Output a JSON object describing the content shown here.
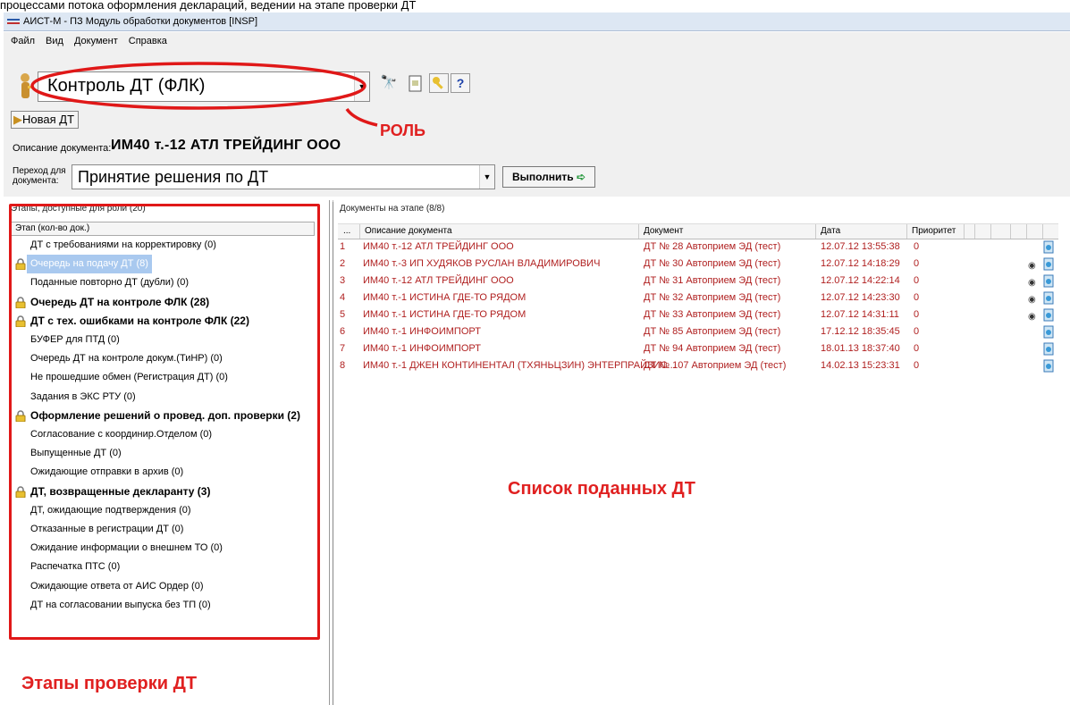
{
  "top_text": "процессами потока оформления деклараций, ведении на этапе проверки ДТ",
  "window": {
    "title": "АИСТ-М - ПЗ Модуль обработки документов [INSP]"
  },
  "menu": [
    "Файл",
    "Вид",
    "Документ",
    "Справка"
  ],
  "role": {
    "value": "Контроль ДТ (ФЛК)"
  },
  "toolbar": {
    "new_dt": "Новая ДТ",
    "exec": "Выполнить"
  },
  "document": {
    "desc_label": "Описание документа:",
    "desc_value": "ИМ40 т.-12 АТЛ ТРЕЙДИНГ ООО",
    "transition_label_1": "Переход для",
    "transition_label_2": "документа:",
    "transition_value": "Принятие решения по ДТ"
  },
  "stages_panel": {
    "caption": "Этапы, доступные для роли (20)",
    "header": "Этап (кол-во док.)",
    "items": [
      {
        "label": "ДТ с требованиями на корректировку (0)",
        "bold": false,
        "lock": false,
        "selected": false
      },
      {
        "label": "Очередь на подачу ДТ (8)",
        "bold": false,
        "lock": true,
        "selected": true
      },
      {
        "label": "Поданные повторно ДТ (дубли) (0)",
        "bold": false,
        "lock": false,
        "selected": false
      },
      {
        "label": "Очередь ДТ на контроле ФЛК (28)",
        "bold": true,
        "lock": true,
        "selected": false
      },
      {
        "label": "ДТ с тех. ошибками на контроле ФЛК (22)",
        "bold": true,
        "lock": true,
        "selected": false
      },
      {
        "label": "БУФЕР для ПТД (0)",
        "bold": false,
        "lock": false,
        "selected": false
      },
      {
        "label": "Очередь ДТ на контроле докум.(ТиНР) (0)",
        "bold": false,
        "lock": false,
        "selected": false
      },
      {
        "label": "Не прошедшие обмен (Регистрация ДТ) (0)",
        "bold": false,
        "lock": false,
        "selected": false
      },
      {
        "label": "Задания в ЭКС РТУ (0)",
        "bold": false,
        "lock": false,
        "selected": false
      },
      {
        "label": "Оформление решений о провед. доп. проверки (2)",
        "bold": true,
        "lock": true,
        "selected": false
      },
      {
        "label": "Согласование с координир.Отделом (0)",
        "bold": false,
        "lock": false,
        "selected": false
      },
      {
        "label": "Выпущенные ДТ (0)",
        "bold": false,
        "lock": false,
        "selected": false
      },
      {
        "label": "Ожидающие отправки в архив (0)",
        "bold": false,
        "lock": false,
        "selected": false
      },
      {
        "label": "ДТ, возвращенные декларанту (3)",
        "bold": true,
        "lock": true,
        "selected": false
      },
      {
        "label": "ДТ, ожидающие подтверждения (0)",
        "bold": false,
        "lock": false,
        "selected": false
      },
      {
        "label": "Отказанные в регистрации ДТ (0)",
        "bold": false,
        "lock": false,
        "selected": false
      },
      {
        "label": "Ожидание информации о внешнем ТО (0)",
        "bold": false,
        "lock": false,
        "selected": false
      },
      {
        "label": "Распечатка ПТС (0)",
        "bold": false,
        "lock": false,
        "selected": false
      },
      {
        "label": "Ожидающие ответа от АИС Ордер (0)",
        "bold": false,
        "lock": false,
        "selected": false
      },
      {
        "label": "ДТ на согласовании выпуска без ТП (0)",
        "bold": false,
        "lock": false,
        "selected": false
      }
    ]
  },
  "docs_panel": {
    "caption": "Документы на этапе (8/8)",
    "columns": [
      "...",
      "Описание документа",
      "Документ",
      "Дата",
      "Приоритет"
    ],
    "rows": [
      {
        "n": "1",
        "desc": "ИМ40 т.-12 АТЛ ТРЕЙДИНГ ООО",
        "doc": "ДТ № 28 Автоприем ЭД (тест)",
        "date": "12.07.12 13:55:38",
        "prio": "0",
        "eye": false
      },
      {
        "n": "2",
        "desc": "ИМ40 т.-3 ИП ХУДЯКОВ РУСЛАН ВЛАДИМИРОВИЧ",
        "doc": "ДТ № 30 Автоприем ЭД (тест)",
        "date": "12.07.12 14:18:29",
        "prio": "0",
        "eye": true
      },
      {
        "n": "3",
        "desc": "ИМ40 т.-12 АТЛ ТРЕЙДИНГ ООО",
        "doc": "ДТ № 31 Автоприем ЭД (тест)",
        "date": "12.07.12 14:22:14",
        "prio": "0",
        "eye": true
      },
      {
        "n": "4",
        "desc": "ИМ40 т.-1 ИСТИНА ГДЕ-ТО РЯДОМ",
        "doc": "ДТ № 32 Автоприем ЭД (тест)",
        "date": "12.07.12 14:23:30",
        "prio": "0",
        "eye": true
      },
      {
        "n": "5",
        "desc": "ИМ40 т.-1 ИСТИНА ГДЕ-ТО РЯДОМ",
        "doc": "ДТ № 33 Автоприем ЭД (тест)",
        "date": "12.07.12 14:31:11",
        "prio": "0",
        "eye": true
      },
      {
        "n": "6",
        "desc": "ИМ40 т.-1 ИНФОИМПОРТ",
        "doc": "ДТ № 85 Автоприем ЭД (тест)",
        "date": "17.12.12 18:35:45",
        "prio": "0",
        "eye": false
      },
      {
        "n": "7",
        "desc": "ИМ40 т.-1 ИНФОИМПОРТ",
        "doc": "ДТ № 94 Автоприем ЭД (тест)",
        "date": "18.01.13 18:37:40",
        "prio": "0",
        "eye": false
      },
      {
        "n": "8",
        "desc": "ИМ40 т.-1 ДЖЕН КОНТИНЕНТАЛ (ТХЯНЬЦЗИН) ЭНТЕРПРАЙЗИС...",
        "doc": "ДТ № 107 Автоприем ЭД (тест)",
        "date": "14.02.13 15:23:31",
        "prio": "0",
        "eye": false
      }
    ]
  },
  "annotations": {
    "role": "РОЛЬ",
    "list": "Список поданных ДТ",
    "stages": "Этапы проверки ДТ",
    "color": "#e02020"
  },
  "icons": {
    "role": "person-key-icon",
    "search": "binoculars-icon",
    "props": "document-props-icon",
    "key": "key-icon",
    "help": "help-icon",
    "lock": "lock-icon",
    "eye": "eye-icon",
    "doc": "doc-status-icon"
  }
}
